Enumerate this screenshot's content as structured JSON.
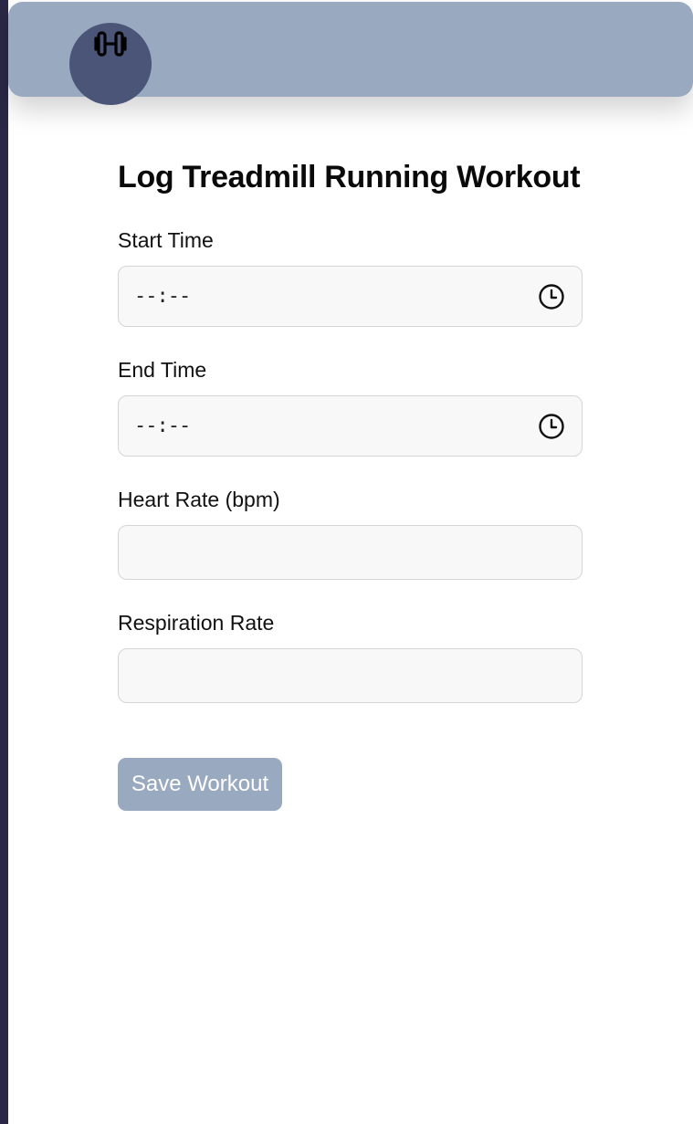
{
  "nav": {
    "items": [
      {
        "icon": "dumbbell-icon",
        "active": true
      },
      {
        "icon": "clipboard-list-icon",
        "active": false
      },
      {
        "icon": "user-circle-icon",
        "active": false
      }
    ],
    "bar_color": "#99a9c0",
    "active_color": "#4b5577"
  },
  "form": {
    "title": "Log Treadmill Running Workout",
    "start_time": {
      "label": "Start Time",
      "value": "--:--"
    },
    "end_time": {
      "label": "End Time",
      "value": "--:--"
    },
    "heart_rate": {
      "label": "Heart Rate (bpm)",
      "value": ""
    },
    "respiration_rate": {
      "label": "Respiration Rate",
      "value": ""
    },
    "save_label": "Save Workout"
  }
}
